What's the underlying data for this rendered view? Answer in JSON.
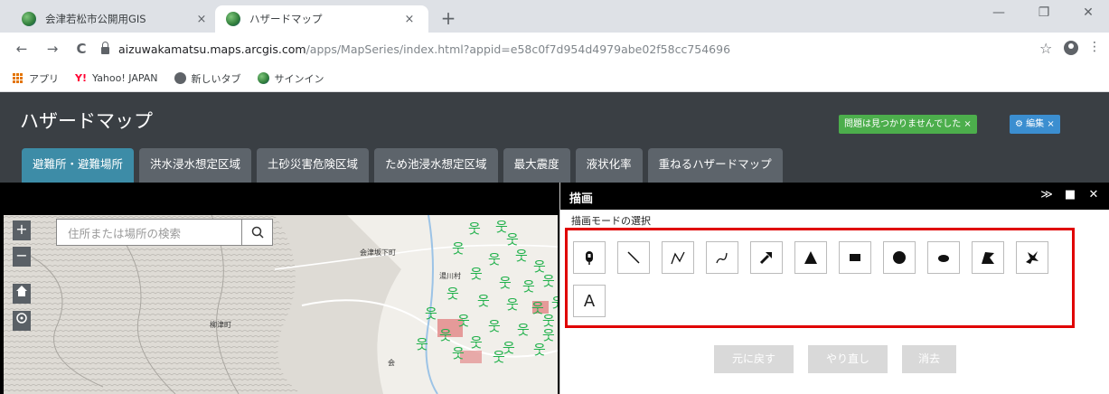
{
  "browser": {
    "tabs": [
      {
        "title": "会津若松市公開用GIS",
        "close": "×"
      },
      {
        "title": "ハザードマップ",
        "close": "×"
      }
    ],
    "new_tab": "+",
    "window_controls": {
      "minimize": "—",
      "restore": "❐",
      "close": "✕"
    },
    "nav": {
      "back": "←",
      "forward": "→",
      "reload": "C"
    },
    "url_host": "aizuwakamatsu.maps.arcgis.com",
    "url_path": "/apps/MapSeries/index.html?appid=e58c0f7d954d4979abe02f58cc754696",
    "star": "☆",
    "menu": "⋮",
    "bookmarks": [
      {
        "label": "アプリ",
        "icon": "apps-grid-icon"
      },
      {
        "label": "Yahoo! JAPAN",
        "icon_text": "Y!",
        "icon": "yahoo-icon"
      },
      {
        "label": "新しいタブ",
        "icon": "globe-icon"
      },
      {
        "label": "サインイン",
        "icon": "gis-icon"
      }
    ]
  },
  "app": {
    "title": "ハザードマップ",
    "notice": "問題は見つかりませんでした ×",
    "edit": "⚙ 編集 ×",
    "tabs": [
      {
        "label": "避難所・避難場所",
        "active": true
      },
      {
        "label": "洪水浸水想定区域"
      },
      {
        "label": "土砂災害危険区域"
      },
      {
        "label": "ため池浸水想定区域"
      },
      {
        "label": "最大震度"
      },
      {
        "label": "液状化率"
      },
      {
        "label": "重ねるハザードマップ"
      }
    ]
  },
  "map": {
    "zoom_in": "+",
    "zoom_out": "−",
    "search_placeholder": "住所または場所の検索",
    "labels": {
      "town1": "会津坂下町",
      "village": "湯川村",
      "town2": "柳津町",
      "partial": "会"
    }
  },
  "panel": {
    "title": "描画",
    "collapse": "≫",
    "maximize": "■",
    "close": "✕",
    "mode_label": "描画モードの選択",
    "text_tool": "A",
    "buttons": {
      "undo": "元に戻す",
      "redo": "やり直し",
      "clear": "消去"
    }
  },
  "colors": {
    "app_header": "#3a3f44",
    "active_tab": "#3d8ca7",
    "inactive_tab": "#5d646b",
    "notice_green": "#4cae4c",
    "edit_blue": "#3b8ed0",
    "highlight_red": "#e00000",
    "shelter_green": "#22b14c"
  }
}
